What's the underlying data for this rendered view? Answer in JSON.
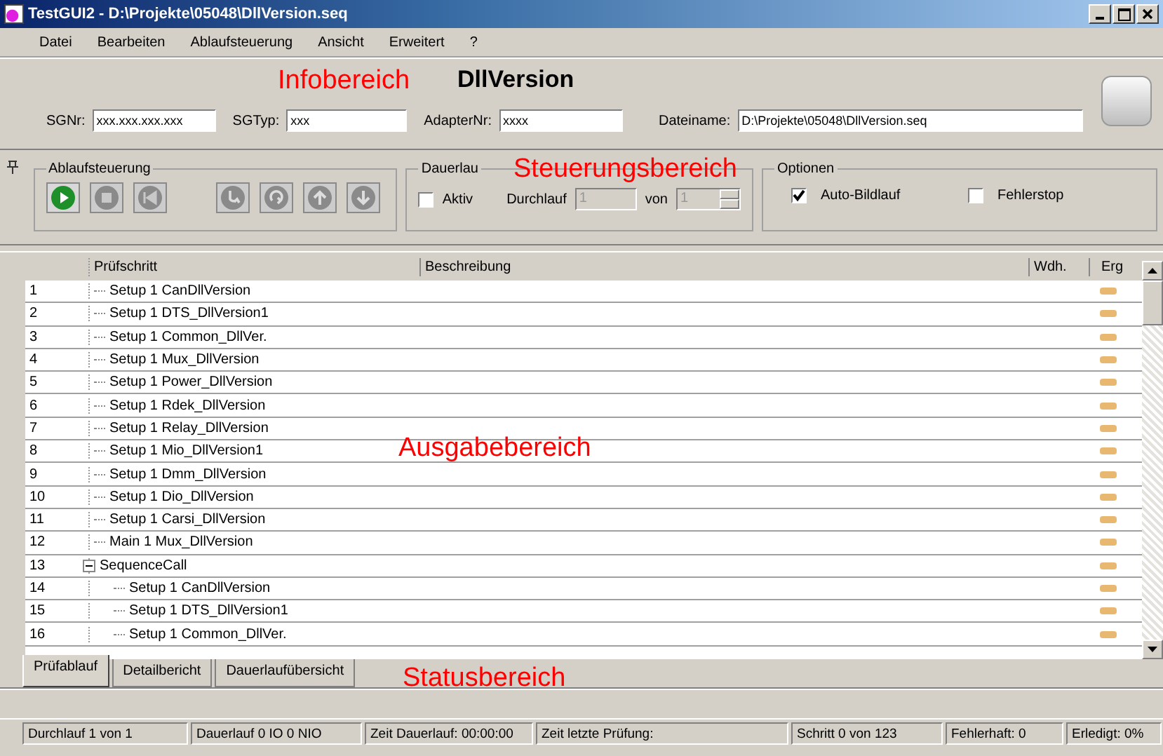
{
  "window": {
    "title": "TestGUI2 - D:\\Projekte\\05048\\DllVersion.seq"
  },
  "menu": [
    "Datei",
    "Bearbeiten",
    "Ablaufsteuerung",
    "Ansicht",
    "Erweitert",
    "?"
  ],
  "info": {
    "annotation": "Infobereich",
    "heading": "DllVersion",
    "fields": [
      {
        "label": "SGNr:",
        "value": "xxx.xxx.xxx.xxx"
      },
      {
        "label": "SGTyp:",
        "value": "xxx"
      },
      {
        "label": "AdapterNr:",
        "value": "xxxx"
      },
      {
        "label": "Dateiname:",
        "value": "D:\\Projekte\\05048\\DllVersion.seq"
      }
    ]
  },
  "control": {
    "annotation": "Steuerungsbereich",
    "sequence": {
      "legend": "Ablaufsteuerung",
      "buttons": [
        {
          "kind": "play",
          "disabled": false
        },
        {
          "kind": "stop",
          "disabled": true
        },
        {
          "kind": "rewind",
          "disabled": true
        },
        {
          "kind": "curve",
          "disabled": true
        },
        {
          "kind": "loop",
          "disabled": true
        },
        {
          "kind": "up",
          "disabled": true
        },
        {
          "kind": "down",
          "disabled": true
        }
      ]
    },
    "endurance": {
      "legend": "Dauerlau",
      "active": {
        "label": "Aktiv",
        "checked": false
      },
      "run_label": "Durchlauf",
      "run_value": "1",
      "of_label": "von",
      "of_value": "1",
      "disabled": true
    },
    "options": {
      "legend": "Optionen",
      "items": [
        {
          "label": "Auto-Bildlauf",
          "checked": true
        },
        {
          "label": "Fehlerstop",
          "checked": false
        }
      ]
    }
  },
  "table": {
    "annotation": "Ausgabebereich",
    "columns": [
      "Prüfschritt",
      "Beschreibung",
      "Wdh.",
      "Erg"
    ],
    "rows": [
      {
        "number": "1",
        "step": "Setup 1 CanDllVersion"
      },
      {
        "number": "2",
        "step": "Setup 1 DTS_DllVersion1"
      },
      {
        "number": "3",
        "step": "Setup 1 Common_DllVer."
      },
      {
        "number": "4",
        "step": "Setup 1 Mux_DllVersion"
      },
      {
        "number": "5",
        "step": "Setup 1 Power_DllVersion"
      },
      {
        "number": "6",
        "step": "Setup 1 Rdek_DllVersion"
      },
      {
        "number": "7",
        "step": "Setup 1 Relay_DllVersion"
      },
      {
        "number": "8",
        "step": "Setup 1 Mio_DllVersion1"
      },
      {
        "number": "9",
        "step": "Setup 1 Dmm_DllVersion"
      },
      {
        "number": "10",
        "step": "Setup 1 Dio_DllVersion"
      },
      {
        "number": "11",
        "step": "Setup 1 Carsi_DllVersion"
      },
      {
        "number": "12",
        "step": "Main 1 Mux_DllVersion"
      },
      {
        "number": "13",
        "step": "SequenceCall",
        "expanded": true,
        "children": [
          {
            "number": "14",
            "step": "Setup 1 CanDllVersion"
          },
          {
            "number": "15",
            "step": "Setup 1 DTS_DllVersion1"
          },
          {
            "number": "16",
            "step": "Setup 1 Common_DllVer."
          }
        ]
      }
    ]
  },
  "tabs": [
    {
      "label": "Prüfablauf",
      "selected": true
    },
    {
      "label": "Detailbericht",
      "selected": false
    },
    {
      "label": "Dauerlaufübersicht",
      "selected": false
    }
  ],
  "status_annotation": "Statusbereich",
  "status_bar": [
    "Durchlauf 1 von 1",
    "Dauerlauf 0 IO 0 NIO",
    "Zeit Dauerlauf: 00:00:00",
    "Zeit letzte Prüfung:",
    "Schritt 0 von 123",
    "Fehlerhaft: 0",
    "Erledigt: 0%"
  ]
}
